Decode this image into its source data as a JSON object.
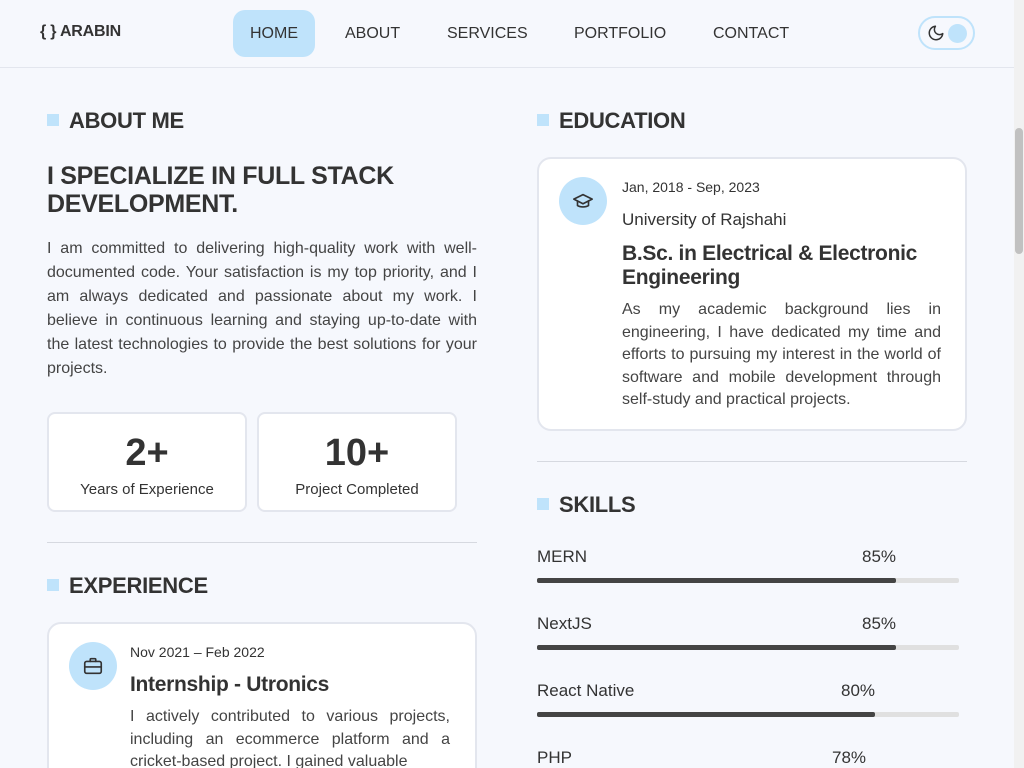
{
  "nav": {
    "logo": "{ } ARABIN",
    "items": [
      "HOME",
      "ABOUT",
      "SERVICES",
      "PORTFOLIO",
      "CONTACT"
    ],
    "active": "HOME",
    "theme_icon": "moon-icon"
  },
  "about": {
    "title": "ABOUT ME",
    "heading": "I SPECIALIZE IN FULL STACK DEVELOPMENT.",
    "text": "I am committed to delivering high-quality work with well-documented code. Your satisfaction is my top priority, and I am always dedicated and passionate about my work. I believe in continuous learning and staying up-to-date with the latest technologies to provide the best solutions for your projects.",
    "stats": [
      {
        "value": "2+",
        "label": "Years of Experience"
      },
      {
        "value": "10+",
        "label": "Project Completed"
      }
    ]
  },
  "experience": {
    "title": "EXPERIENCE",
    "items": [
      {
        "date": "Nov 2021 – Feb 2022",
        "role": "Internship - Utronics",
        "desc": "I actively contributed to various projects, including an ecommerce platform and a cricket-based project. I gained valuable",
        "icon": "briefcase-icon"
      }
    ]
  },
  "education": {
    "title": "EDUCATION",
    "items": [
      {
        "date": "Jan, 2018 - Sep, 2023",
        "institution": "University of Rajshahi",
        "degree": "B.Sc. in Electrical & Electronic Engineering",
        "desc": "As my academic background lies in engineering, I have dedicated my time and efforts to pursuing my interest in the world of software and mobile development through self-study and practical projects.",
        "icon": "graduation-cap-icon"
      }
    ]
  },
  "skills": {
    "title": "SKILLS",
    "items": [
      {
        "name": "MERN",
        "percent": 85,
        "label": "85%"
      },
      {
        "name": "NextJS",
        "percent": 85,
        "label": "85%"
      },
      {
        "name": "React Native",
        "percent": 80,
        "label": "80%"
      },
      {
        "name": "PHP",
        "percent": 78,
        "label": "78%"
      }
    ]
  },
  "colors": {
    "accent": "#bfe3fb",
    "background": "#f6f8fd",
    "bar": "#444444"
  }
}
